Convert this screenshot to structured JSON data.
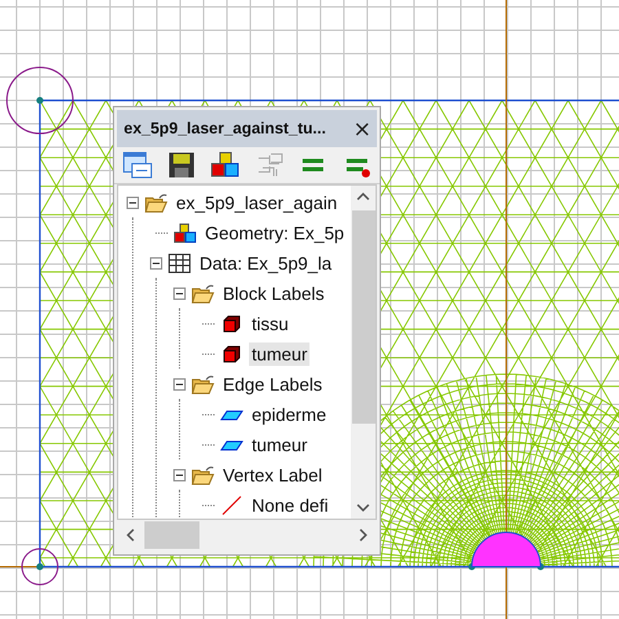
{
  "window": {
    "title": "ex_5p9_laser_against_tu...",
    "close": "×"
  },
  "toolbar": [
    {
      "kind": "window",
      "disabled": false
    },
    {
      "kind": "save",
      "disabled": false
    },
    {
      "kind": "blocks",
      "disabled": false
    },
    {
      "kind": "connector",
      "disabled": true
    },
    {
      "kind": "equals",
      "disabled": false
    },
    {
      "kind": "equals-dot",
      "disabled": false
    }
  ],
  "tree": [
    {
      "label": "ex_5p9_laser_again",
      "kind": "folder",
      "expanded": true,
      "selected": false,
      "children": [
        {
          "label": "Geometry: Ex_5p",
          "kind": "geometry",
          "selected": false
        },
        {
          "label": "Data: Ex_5p9_la",
          "kind": "table",
          "expanded": true,
          "selected": false,
          "children": [
            {
              "label": "Block Labels",
              "kind": "folder",
              "expanded": true,
              "selected": false,
              "children": [
                {
                  "label": "tissu",
                  "kind": "block",
                  "selected": false
                },
                {
                  "label": "tumeur",
                  "kind": "block",
                  "selected": true
                }
              ]
            },
            {
              "label": "Edge Labels",
              "kind": "folder",
              "expanded": true,
              "selected": false,
              "children": [
                {
                  "label": "epiderme",
                  "kind": "edge",
                  "selected": false
                },
                {
                  "label": "tumeur",
                  "kind": "edge",
                  "selected": false
                }
              ]
            },
            {
              "label": "Vertex Label",
              "kind": "folder",
              "expanded": true,
              "selected": false,
              "children": [
                {
                  "label": "None defi",
                  "kind": "vertex",
                  "selected": false
                }
              ]
            }
          ]
        }
      ]
    }
  ]
}
